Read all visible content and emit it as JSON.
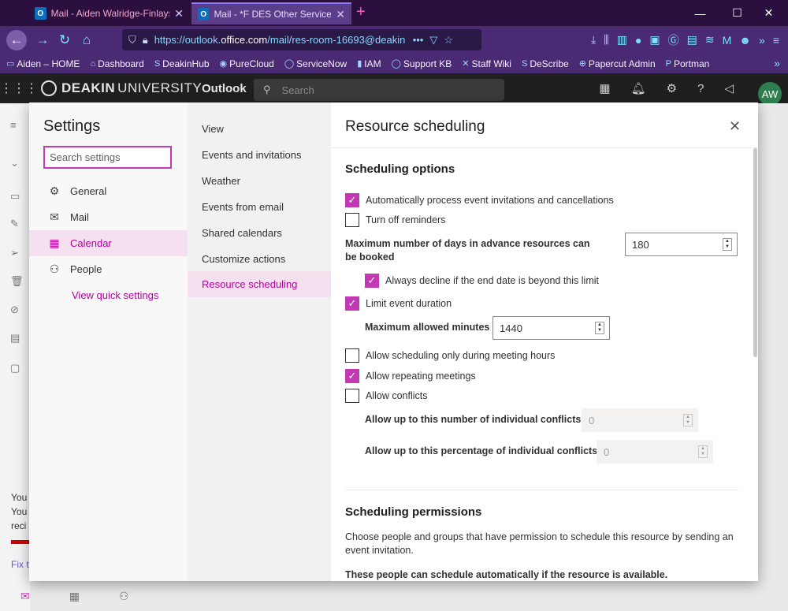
{
  "browser": {
    "tabs": [
      {
        "icon": "O",
        "title": "Mail - Aiden Walridge-Finlayson"
      },
      {
        "icon": "O",
        "title": "Mail - *F DES Other Service Desk"
      }
    ],
    "new_tab": "+",
    "window_controls": [
      "—",
      "☐",
      "✕"
    ],
    "url_prefix": "https://outlook.",
    "url_domain": "office.com",
    "url_path": "/mail/res-room-16693@deakin",
    "url_more": "•••",
    "bookmarks": [
      "Aiden – HOME",
      "Dashboard",
      "DeakinHub",
      "PureCloud",
      "ServiceNow",
      "IAM",
      "Support KB",
      "Staff Wiki",
      "DeScribe",
      "Papercut Admin",
      "Portman"
    ],
    "bookmarks_more": "»"
  },
  "app": {
    "brand_bold": "DEAKIN",
    "brand_rest": "UNIVERSITY",
    "name": "Outlook",
    "search_placeholder": "Search",
    "avatar_initials": "AW"
  },
  "background": {
    "notes": [
      "You",
      "You",
      "reci",
      "Fix t"
    ]
  },
  "settings": {
    "title": "Settings",
    "search_placeholder": "Search settings",
    "categories": [
      "General",
      "Mail",
      "Calendar",
      "People"
    ],
    "selected_category": "Calendar",
    "quick_link": "View quick settings",
    "subcategories": [
      "View",
      "Events and invitations",
      "Weather",
      "Events from email",
      "Shared calendars",
      "Customize actions",
      "Resource scheduling"
    ],
    "selected_subcategory": "Resource scheduling"
  },
  "panel": {
    "title": "Resource scheduling",
    "close": "✕",
    "section1": "Scheduling options",
    "opt_auto_process": "Automatically process event invitations and cancellations",
    "opt_turn_off_reminders": "Turn off reminders",
    "max_days_label": "Maximum number of days in advance resources can be booked",
    "max_days_value": "180",
    "opt_always_decline": "Always decline if the end date is beyond this limit",
    "opt_limit_duration": "Limit event duration",
    "max_minutes_label": "Maximum allowed minutes",
    "max_minutes_value": "1440",
    "opt_meeting_hours": "Allow scheduling only during meeting hours",
    "opt_repeating": "Allow repeating meetings",
    "opt_conflicts": "Allow conflicts",
    "conflicts_count_label": "Allow up to this number of individual conflicts",
    "conflicts_count_value": "0",
    "conflicts_pct_label": "Allow up to this percentage of individual conflicts",
    "conflicts_pct_value": "0",
    "section2": "Scheduling permissions",
    "perm_desc": "Choose people and groups that have permission to schedule this resource by sending an event invitation.",
    "perm_auto": "These people can schedule automatically if the resource is available."
  },
  "checkbox_state": {
    "auto_process": true,
    "turn_off_reminders": false,
    "always_decline": true,
    "limit_duration": true,
    "meeting_hours": false,
    "repeating": true,
    "conflicts": false
  },
  "colors": {
    "accent": "#c239b3",
    "selected_bg": "#f4e0ef",
    "selected_text": "#b4009e"
  }
}
